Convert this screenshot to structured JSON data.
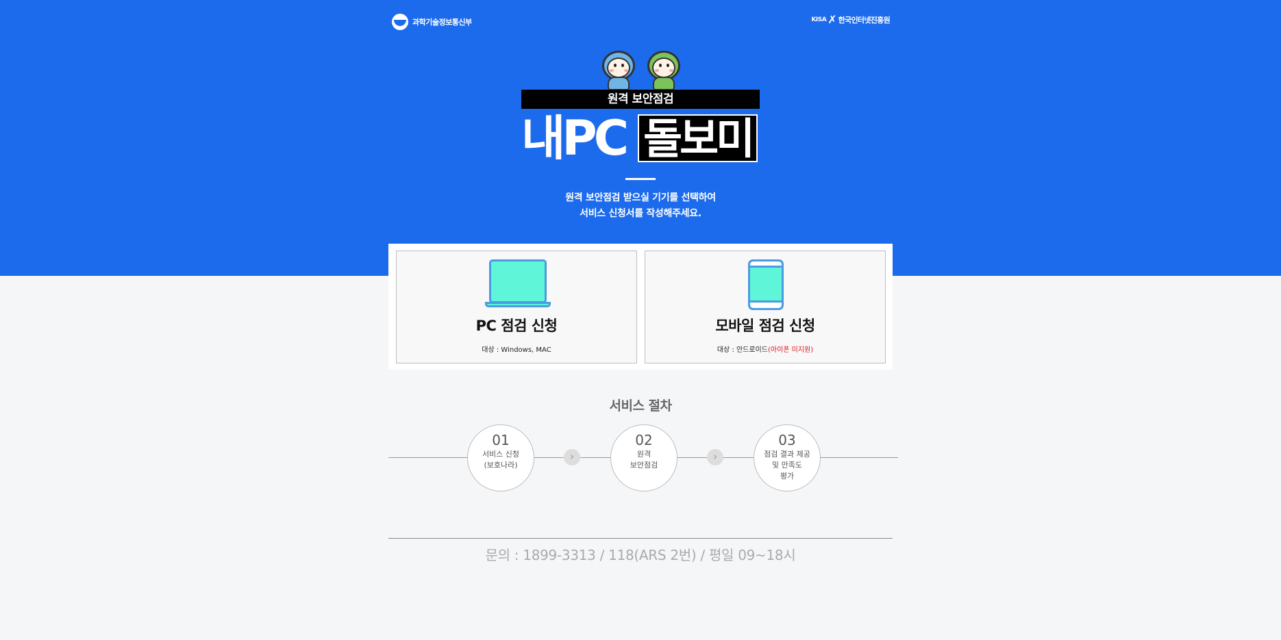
{
  "header": {
    "ministry_logo_text": "과학기술정보통신부",
    "kisa_abbr": "KISA",
    "kisa_logo_text": "한국인터넷진흥원"
  },
  "hero": {
    "subtitle": "원격 보안점검",
    "title_part1": "내PC",
    "title_part2": "돌보미",
    "description_line1": "원격 보안점검 받으실 기기를 선택하여",
    "description_line2": "서비스 신청서를 작성해주세요."
  },
  "cards": {
    "pc": {
      "title": "PC 점검 신청",
      "target": "대상 : Windows, MAC",
      "icon": "laptop-icon"
    },
    "mobile": {
      "title": "모바일 점검 신청",
      "target": "대상 : 안드로이드",
      "target_note": "(아이폰 미지원)",
      "icon": "smartphone-icon"
    }
  },
  "process": {
    "title": "서비스 절차",
    "steps": [
      {
        "num": "01",
        "line1": "서비스 신청",
        "line2": "(보호나라)",
        "line3": ""
      },
      {
        "num": "02",
        "line1": "원격",
        "line2": "보안점검",
        "line3": ""
      },
      {
        "num": "03",
        "line1": "점검 결과 제공",
        "line2": "및 만족도",
        "line3": "평가"
      }
    ],
    "arrow_glyph": "›"
  },
  "footer": {
    "contact": "문의 : 1899-3313 / 118(ARS 2번) / 평일 09~18시"
  },
  "colors": {
    "hero_blue": "#1c6bed",
    "icon_mint": "#5ef5d8",
    "icon_outline": "#4a9be2",
    "warning_red": "#d8141c"
  }
}
